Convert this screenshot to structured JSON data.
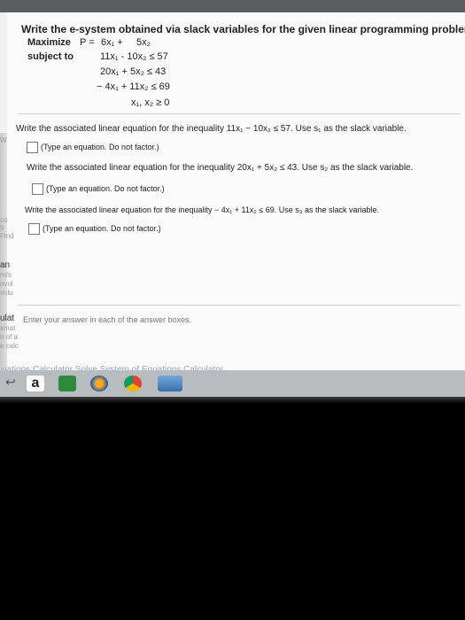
{
  "question": {
    "title": "Write the e-system obtained via slack variables for the given linear programming problem.",
    "maximize_label": "Maximize",
    "objective_prefix": "P =",
    "objective_terms": [
      "6x₁ +",
      "5x₂"
    ],
    "subject_to_label": "subject to",
    "constraints": [
      "11x₁ -  10x₂ ≤ 57",
      "20x₁ +   5x₂ ≤ 43",
      "− 4x₁ +  11x₂ ≤ 69",
      "x₁, x₂ ≥ 0"
    ]
  },
  "parts": [
    {
      "prompt": "Write the associated linear equation for the inequality 11x₁ − 10x₂ ≤ 57. Use s₁ as the slack variable.",
      "hint": "(Type an equation. Do not factor.)"
    },
    {
      "prompt": "Write the associated linear equation for the inequality 20x₁ + 5x₂ ≤ 43. Use s₂ as the slack variable.",
      "hint": "(Type an equation. Do not factor.)"
    },
    {
      "prompt": "Write the associated linear equation for the inequality − 4x₁ + 11x₂ ≤ 69. Use s₃ as the slack variable.",
      "hint": "(Type an equation. Do not factor.)"
    }
  ],
  "instruction": "Enter your answer in each of the answer boxes.",
  "sidebar_fragments": [
    "an",
    "m/s",
    "nvol",
    "volu",
    "ulat",
    "xmat",
    "n of a",
    "e calc",
    "W",
    "co",
    "fr",
    "Find"
  ],
  "bottom_link": "uations Calculator Solve System of Equations Calculator",
  "taskbar": {
    "amazon_label": "a"
  },
  "colors": {
    "screen_bg": "#f1f1f1",
    "link": "#8aa8c8"
  }
}
